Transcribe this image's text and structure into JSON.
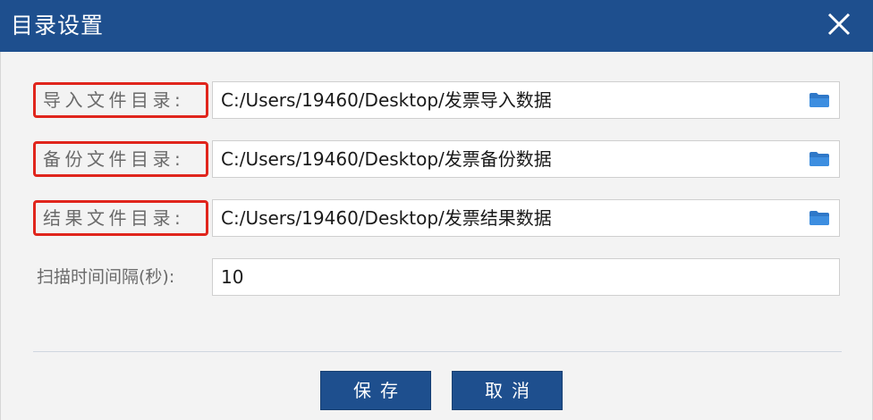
{
  "window": {
    "title": "目录设置",
    "close_icon": "close-icon",
    "titlebar_color": "#1e4f8e"
  },
  "fields": [
    {
      "label": "导入文件目录:",
      "value": "C:/Users/19460/Desktop/发票导入数据",
      "icon": "folder-icon",
      "highlighted": true
    },
    {
      "label": "备份文件目录:",
      "value": "C:/Users/19460/Desktop/发票备份数据",
      "icon": "folder-icon",
      "highlighted": true
    },
    {
      "label": "结果文件目录:",
      "value": "C:/Users/19460/Desktop/发票结果数据",
      "icon": "folder-icon",
      "highlighted": true
    },
    {
      "label": "扫描时间间隔(秒):",
      "value": "10",
      "highlighted": false
    }
  ],
  "buttons": {
    "save_label": "保存",
    "cancel_label": "取消",
    "color": "#1e4f8e"
  },
  "highlight_color": "#e0251c"
}
